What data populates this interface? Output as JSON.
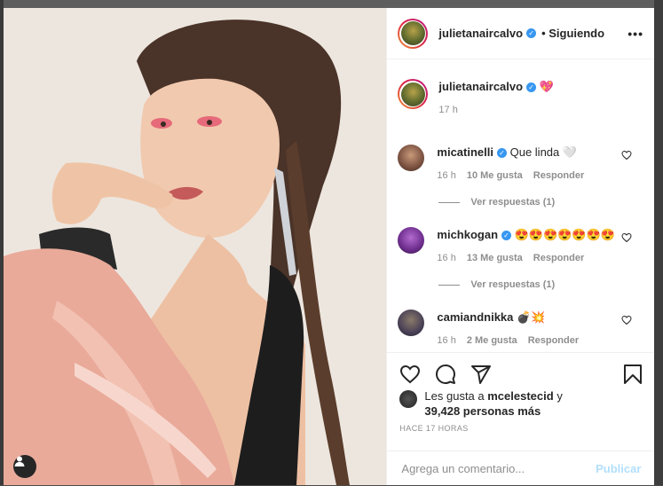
{
  "post": {
    "username": "julietanaircalvo",
    "following_label": "• Siguiendo",
    "more_label": "•••"
  },
  "caption": {
    "username": "julietanaircalvo",
    "text": "💖",
    "time": "17 h"
  },
  "comments": [
    {
      "username": "micatinelli",
      "verified": true,
      "text": "Que linda 🤍",
      "time": "16 h",
      "likes": "10 Me gusta",
      "reply": "Responder",
      "replies": "Ver respuestas (1)"
    },
    {
      "username": "michkogan",
      "verified": true,
      "text": "😍😍😍😍😍😍😍",
      "time": "16 h",
      "likes": "13 Me gusta",
      "reply": "Responder",
      "replies": "Ver respuestas (1)"
    },
    {
      "username": "camiandnikka",
      "verified": false,
      "text": "💣💥",
      "time": "16 h",
      "likes": "2 Me gusta",
      "reply": "Responder",
      "replies": ""
    }
  ],
  "likes": {
    "prefix": "Les gusta a",
    "user": "mcelestecid",
    "suffix": "y",
    "count": "39,428 personas más"
  },
  "timestamp": "HACE 17 HORAS",
  "add_comment": {
    "placeholder": "Agrega un comentario...",
    "publish": "Publicar"
  },
  "icons": {
    "like": "heart-icon",
    "comment": "comment-icon",
    "share": "share-icon",
    "save": "bookmark-icon",
    "tag": "user-tag-icon"
  },
  "colors": {
    "verified": "#3897f0",
    "publish_disabled": "#b2dffc",
    "secondary_text": "#8e8e8e"
  }
}
